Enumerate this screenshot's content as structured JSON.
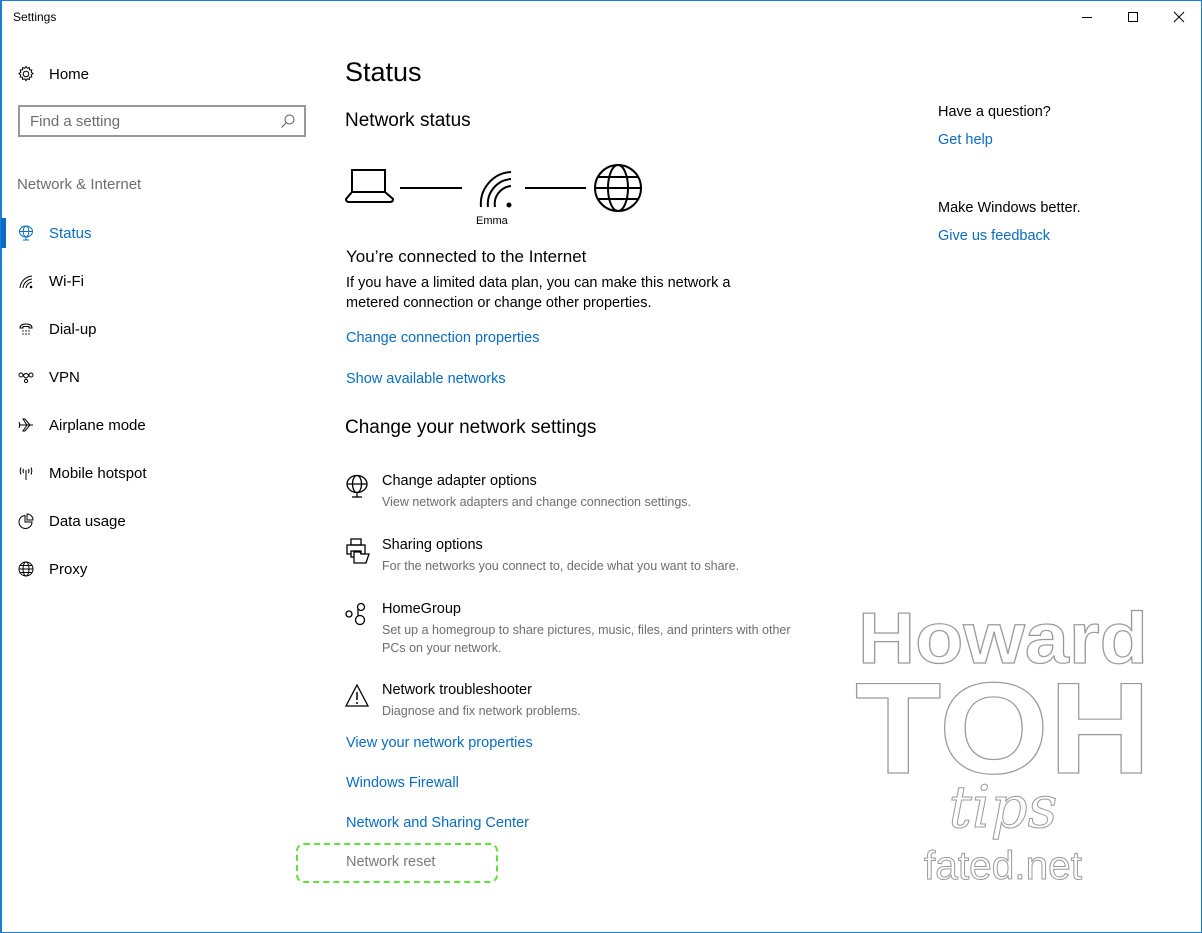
{
  "window": {
    "title": "Settings",
    "controls": {
      "minimize": "minimize",
      "maximize": "maximize",
      "close": "close"
    },
    "accent_color": "#0a6cc2",
    "border_color": "#1a7fd4"
  },
  "sidebar": {
    "home_label": "Home",
    "search_placeholder": "Find a setting",
    "section_title": "Network & Internet",
    "items": [
      {
        "label": "Status",
        "icon": "globe-monitor-icon",
        "active": true
      },
      {
        "label": "Wi-Fi",
        "icon": "wifi-icon",
        "active": false
      },
      {
        "label": "Dial-up",
        "icon": "phone-icon",
        "active": false
      },
      {
        "label": "VPN",
        "icon": "vpn-icon",
        "active": false
      },
      {
        "label": "Airplane mode",
        "icon": "airplane-icon",
        "active": false
      },
      {
        "label": "Mobile hotspot",
        "icon": "hotspot-icon",
        "active": false
      },
      {
        "label": "Data usage",
        "icon": "pie-chart-icon",
        "active": false
      },
      {
        "label": "Proxy",
        "icon": "globe-icon",
        "active": false
      }
    ]
  },
  "main": {
    "page_title": "Status",
    "network_status_heading": "Network status",
    "network_name": "Emma",
    "connected_title": "You’re connected to the Internet",
    "connected_desc": "If you have a limited data plan, you can make this network a metered connection or change other properties.",
    "links_top": [
      "Change connection properties",
      "Show available networks"
    ],
    "change_heading": "Change your network settings",
    "options": [
      {
        "title": "Change adapter options",
        "desc": "View network adapters and change connection settings.",
        "icon": "adapter-icon"
      },
      {
        "title": "Sharing options",
        "desc": "For the networks you connect to, decide what you want to share.",
        "icon": "sharing-icon"
      },
      {
        "title": "HomeGroup",
        "desc": "Set up a homegroup to share pictures, music, files, and printers with other PCs on your network.",
        "icon": "homegroup-icon"
      },
      {
        "title": "Network troubleshooter",
        "desc": "Diagnose and fix network problems.",
        "icon": "warning-icon"
      }
    ],
    "links_bottom": [
      "View your network properties",
      "Windows Firewall",
      "Network and Sharing Center"
    ],
    "network_reset": "Network reset",
    "highlight_color": "#5fe03a"
  },
  "aside": {
    "question": "Have a question?",
    "help_link": "Get help",
    "feedback_prompt": "Make Windows better.",
    "feedback_link": "Give us feedback"
  },
  "watermark": {
    "line1": "Howard",
    "line2": "TOH",
    "line3": "tips",
    "line4": "fated.net"
  }
}
